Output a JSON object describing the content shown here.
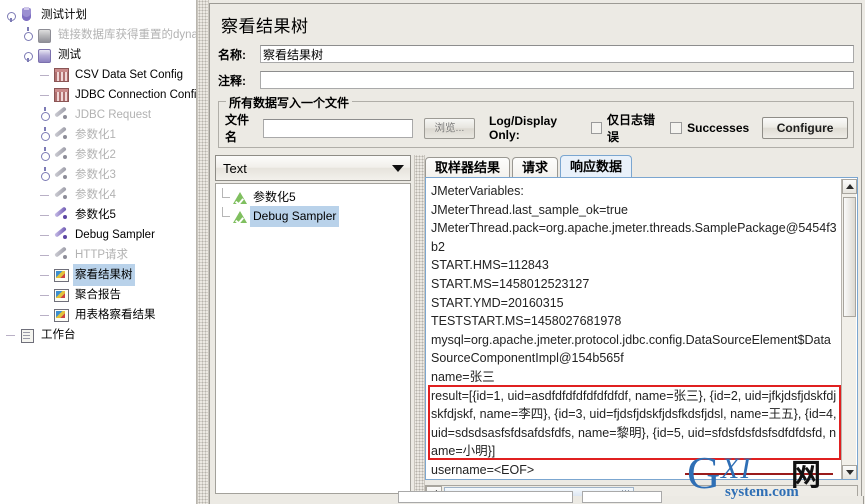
{
  "tree": {
    "items": [
      {
        "label": "测试计划",
        "icon": "test-plan-flask-icon",
        "depth": 0,
        "disabled": false,
        "selected": false,
        "handle": "down"
      },
      {
        "label": "链接数据库获得重置的dynamic ",
        "icon": "thread-group-icon",
        "depth": 1,
        "disabled": true,
        "selected": false,
        "handle": "right"
      },
      {
        "label": "测试",
        "icon": "thread-group-icon",
        "depth": 1,
        "disabled": false,
        "selected": false,
        "handle": "down"
      },
      {
        "label": "CSV Data Set Config",
        "icon": "config-element-icon",
        "depth": 2,
        "disabled": false,
        "selected": false,
        "handle": "none"
      },
      {
        "label": "JDBC Connection Configurat",
        "icon": "config-element-icon",
        "depth": 2,
        "disabled": false,
        "selected": false,
        "handle": "none"
      },
      {
        "label": "JDBC Request",
        "icon": "sampler-icon",
        "depth": 2,
        "disabled": true,
        "selected": false,
        "handle": "right"
      },
      {
        "label": "参数化1",
        "icon": "sampler-icon",
        "depth": 2,
        "disabled": true,
        "selected": false,
        "handle": "right"
      },
      {
        "label": "参数化2",
        "icon": "sampler-icon",
        "depth": 2,
        "disabled": true,
        "selected": false,
        "handle": "right"
      },
      {
        "label": "参数化3",
        "icon": "sampler-icon",
        "depth": 2,
        "disabled": true,
        "selected": false,
        "handle": "right"
      },
      {
        "label": "参数化4",
        "icon": "sampler-icon",
        "depth": 2,
        "disabled": true,
        "selected": false,
        "handle": "none"
      },
      {
        "label": "参数化5",
        "icon": "sampler-icon",
        "depth": 2,
        "disabled": false,
        "selected": false,
        "handle": "none"
      },
      {
        "label": "Debug Sampler",
        "icon": "sampler-icon",
        "depth": 2,
        "disabled": false,
        "selected": false,
        "handle": "none"
      },
      {
        "label": "HTTP请求",
        "icon": "sampler-icon",
        "depth": 2,
        "disabled": true,
        "selected": false,
        "handle": "none"
      },
      {
        "label": "察看结果树",
        "icon": "listener-icon",
        "depth": 2,
        "disabled": false,
        "selected": true,
        "handle": "none"
      },
      {
        "label": "聚合报告",
        "icon": "listener-icon",
        "depth": 2,
        "disabled": false,
        "selected": false,
        "handle": "none"
      },
      {
        "label": "用表格察看结果",
        "icon": "listener-icon",
        "depth": 2,
        "disabled": false,
        "selected": false,
        "handle": "none"
      },
      {
        "label": "工作台",
        "icon": "workbench-icon",
        "depth": 0,
        "disabled": false,
        "selected": false,
        "handle": "none"
      }
    ]
  },
  "panel": {
    "title": "察看结果树",
    "name_label": "名称:",
    "name_value": "察看结果树",
    "comment_label": "注释:",
    "comment_value": "",
    "filegroup_title": "所有数据写入一个文件",
    "filename_label": "文件名",
    "filename_value": "",
    "filename_placeholder": "",
    "browse_label": "浏览...",
    "logdisplay_label": "Log/Display Only:",
    "errors_only_label": "仅日志错误",
    "errors_only_checked": false,
    "successes_label": "Successes",
    "successes_checked": false,
    "configure_label": "Configure"
  },
  "viewer": {
    "render_selected": "Text",
    "results": [
      {
        "label": "参数化5",
        "status": "success",
        "selected": false
      },
      {
        "label": "Debug Sampler",
        "status": "success",
        "selected": true
      }
    ]
  },
  "tabs": [
    {
      "label": "取样器结果",
      "active": false
    },
    {
      "label": "请求",
      "active": false
    },
    {
      "label": "响应数据",
      "active": true
    }
  ],
  "response": {
    "text": "JMeterVariables:\nJMeterThread.last_sample_ok=true\nJMeterThread.pack=org.apache.jmeter.threads.SamplePackage@5454f3b2\nSTART.HMS=112843\nSTART.MS=1458012523127\nSTART.YMD=20160315\nTESTSTART.MS=1458027681978\nmysql=org.apache.jmeter.protocol.jdbc.config.DataSourceElement$DataSourceComponentImpl@154b565f\nname=张三\nresult=[{id=1, uid=asdfdfdfdfdfdfdfdf, name=张三}, {id=2, uid=jfkjdsfjdskfdjskfdjskf, name=李四}, {id=3, uid=fjdsfjdskfjdsfkdsfjdsl, name=王五}, {id=4, uid=sdsdsasfsfdsafdsfdfs, name=黎明}, {id=5, uid=sfdsfdsfdsfsdfdfdsfd, name=小明}]\nusername=<EOF>",
    "highlight_color": "#e02020"
  },
  "watermark": {
    "g": "G",
    "xi": "XI",
    "wang": "网",
    "sub": "system.com"
  }
}
